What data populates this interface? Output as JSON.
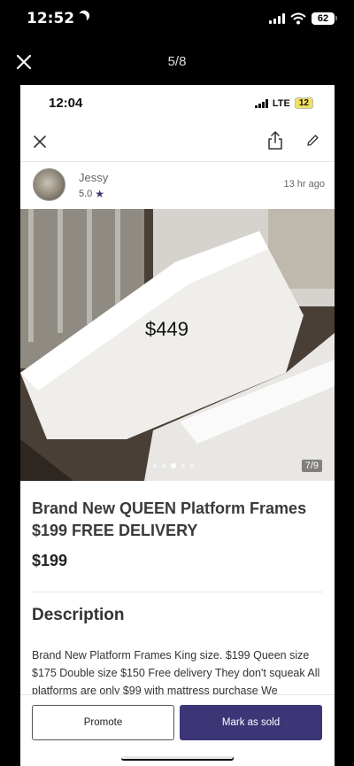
{
  "outer_status": {
    "time": "12:52",
    "battery": "62"
  },
  "viewer": {
    "counter": "5/8"
  },
  "inner_status": {
    "time": "12:04",
    "network": "LTE",
    "battery": "12"
  },
  "seller": {
    "name": "Jessy",
    "rating": "5.0",
    "posted": "13 hr  ago"
  },
  "photo": {
    "overlay_text": "$449",
    "count": "7/9",
    "dots": 5,
    "active_dot": 2
  },
  "listing": {
    "title": "Brand New QUEEN Platform Frames $199 FREE DELIVERY",
    "price": "$199",
    "description_heading": "Description",
    "description_body": "Brand New Platform Frames King size. $199 Queen size $175 Double size $150 Free delivery They don't squeak All platforms are only $99 with mattress purchase We"
  },
  "actions": {
    "promote_label": "Promote",
    "mark_sold_label": "Mark as sold"
  },
  "colors": {
    "accent": "#3c3677",
    "star": "#38386b",
    "battery_low": "#f2df5f"
  },
  "icons": [
    "moon-icon",
    "signal-icon",
    "wifi-icon",
    "battery-icon",
    "close-icon",
    "share-icon",
    "edit-icon",
    "star-icon"
  ]
}
